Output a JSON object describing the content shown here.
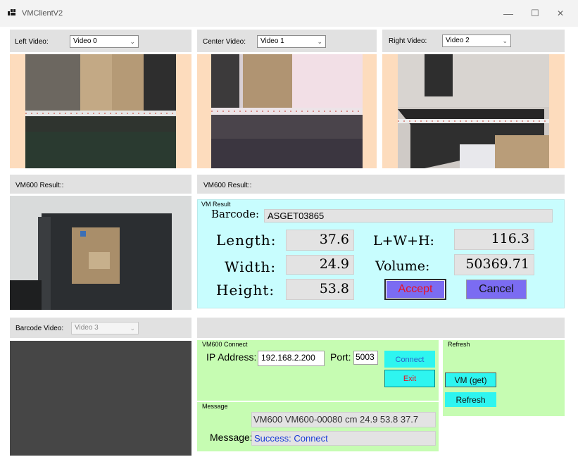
{
  "window": {
    "title": "VMClientV2",
    "min": "—",
    "max": "☐",
    "close": "✕"
  },
  "left": {
    "label": "Left Video:",
    "value": "Video 0"
  },
  "center": {
    "label": "Center Video:",
    "value": "Video 1"
  },
  "right": {
    "label": "Right Video:",
    "value": "Video 2"
  },
  "result_left": {
    "label": "VM600 Result::"
  },
  "result_right": {
    "label": "VM600 Result::"
  },
  "vm_result": {
    "group": "VM Result",
    "barcode_label": "Barcode:",
    "barcode": "ASGET03865",
    "length_label": "Length:",
    "length": "37.6",
    "width_label": "Width:",
    "width": "24.9",
    "height_label": "Height:",
    "height": "53.8",
    "lwh_label": "L+W+H:",
    "lwh": "116.3",
    "volume_label": "Volume:",
    "volume": "50369.71",
    "accept": "Accept",
    "cancel": "Cancel"
  },
  "barcode_video": {
    "label": "Barcode Video:",
    "value": "Video 3"
  },
  "connect": {
    "group": "VM600 Connect",
    "ip_label": "IP Address:",
    "ip": "192.168.2.200",
    "port_label": "Port:",
    "port": "5003",
    "connect_btn": "Connect",
    "exit_btn": "Exit"
  },
  "refresh": {
    "group": "Refresh",
    "vm_get": "VM (get)",
    "refresh_btn": "Refresh"
  },
  "message": {
    "group": "Message",
    "data_line": "VM600 VM600-00080  cm  24.9  53.8  37.7",
    "label": "Message:",
    "text": "Success: Connect"
  },
  "colors": {
    "result_bg": "#c8fdfe",
    "connect_bg": "#c6fcb2",
    "accept_text": "#e81123",
    "button_blue": "#7b6cf2",
    "cyan_button": "#2ef5f0"
  }
}
